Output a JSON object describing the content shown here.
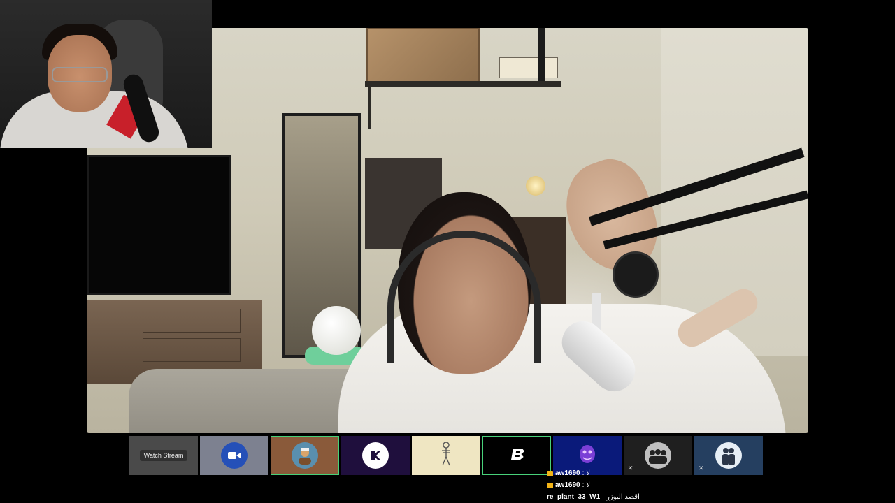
{
  "webcam": {
    "label": ""
  },
  "strip": {
    "tiles": [
      {
        "label": "Watch Stream",
        "bg": "#4a4a4a"
      },
      {
        "bg": "#7d8190",
        "circle": "#2550b8",
        "icon": "video-camera-icon"
      },
      {
        "bg": "#8a5a3a",
        "circle": "#5a8fae",
        "icon": "avatar-man-icon"
      },
      {
        "bg": "#1f0f3d",
        "circle": "#ffffff",
        "icon": "k-logo-icon"
      },
      {
        "bg": "#efe6c2",
        "icon": "skeleton-icon"
      },
      {
        "bg": "#000000",
        "icon": "b-logo-icon"
      },
      {
        "bg": "#0a1a7a",
        "icon": "purple-creature-icon"
      },
      {
        "bg": "#1f1f1f",
        "circle": "#bfbfbf",
        "icon": "group-photo-icon"
      },
      {
        "bg": "#253f60",
        "circle": "#e6eef5",
        "icon": "couple-photo-icon"
      }
    ]
  },
  "chat": {
    "messages": [
      {
        "user": "aw1690",
        "sep": " : ",
        "text": "لا"
      },
      {
        "user": "aw1690",
        "sep": " : ",
        "text": "لا"
      },
      {
        "user": "re_plant_33_W1",
        "sep": " : ",
        "text": "اقصد اليوزر"
      }
    ],
    "badge_color": "#f2b417"
  }
}
